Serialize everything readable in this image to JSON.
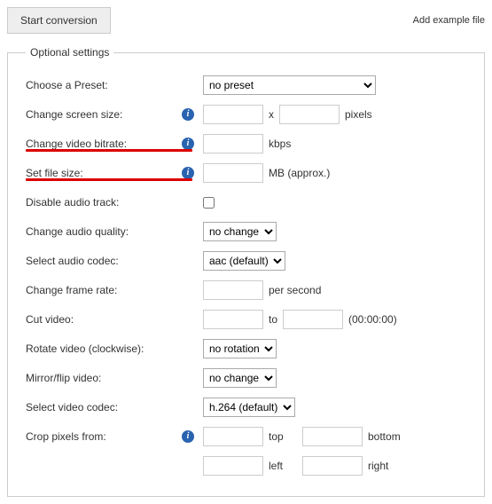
{
  "top": {
    "start_button": "Start conversion",
    "add_link": "Add example file"
  },
  "legend": "Optional settings",
  "rows": {
    "preset": {
      "label": "Choose a Preset:",
      "value": "no preset"
    },
    "screen_size": {
      "label": "Change screen size:",
      "sep": "x",
      "unit": "pixels"
    },
    "video_bitrate": {
      "label": "Change video bitrate:",
      "unit": "kbps"
    },
    "file_size": {
      "label": "Set file size:",
      "unit": "MB (approx.)"
    },
    "disable_audio": {
      "label": "Disable audio track:"
    },
    "audio_quality": {
      "label": "Change audio quality:",
      "value": "no change"
    },
    "audio_codec": {
      "label": "Select audio codec:",
      "value": "aac (default)"
    },
    "frame_rate": {
      "label": "Change frame rate:",
      "unit": "per second"
    },
    "cut_video": {
      "label": "Cut video:",
      "sep": "to",
      "hint": "(00:00:00)"
    },
    "rotate": {
      "label": "Rotate video (clockwise):",
      "value": "no rotation"
    },
    "mirror": {
      "label": "Mirror/flip video:",
      "value": "no change"
    },
    "video_codec": {
      "label": "Select video codec:",
      "value": "h.264 (default)"
    },
    "crop": {
      "label": "Crop pixels from:",
      "top": "top",
      "bottom": "bottom",
      "left": "left",
      "right": "right"
    }
  },
  "info_glyph": "i"
}
